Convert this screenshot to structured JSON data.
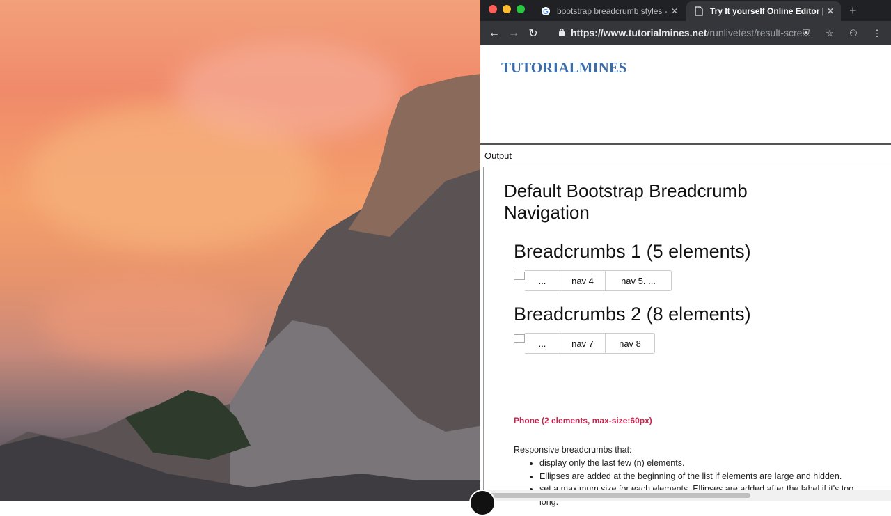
{
  "browser": {
    "tabs": [
      {
        "title": "bootstrap breadcrumb styles -",
        "icon": "google-icon"
      },
      {
        "title": "Try It yourself Online Editor | Tu",
        "icon": "page-icon"
      }
    ],
    "url_host": "https://www.tutorialmines.net",
    "url_path": "/runlivetest/result-scre..."
  },
  "page": {
    "brand": "TUTORIALMINES",
    "output_label": "Output",
    "title": "Default Bootstrap Breadcrumb Navigation",
    "bc1": {
      "heading": "Breadcrumbs 1 (5 elements)",
      "items": [
        "...",
        "nav 4",
        "nav 5. ..."
      ]
    },
    "bc2": {
      "heading": "Breadcrumbs 2 (8 elements)",
      "items": [
        "...",
        "nav 7",
        "nav 8"
      ]
    },
    "phone_note": "Phone (2 elements, max-size:60px)",
    "intro": "Responsive breadcrumbs that:",
    "features": [
      "display only the last few (n) elements.",
      "Ellipses are added at the beginning of the list if elements are large and hidden.",
      "set a maximum size for each elements. Ellipses are added after the label if it's too long."
    ]
  },
  "colors": {
    "brand": "#3d6da8",
    "phone_note": "#c7254e",
    "chrome_dark": "#202124"
  }
}
